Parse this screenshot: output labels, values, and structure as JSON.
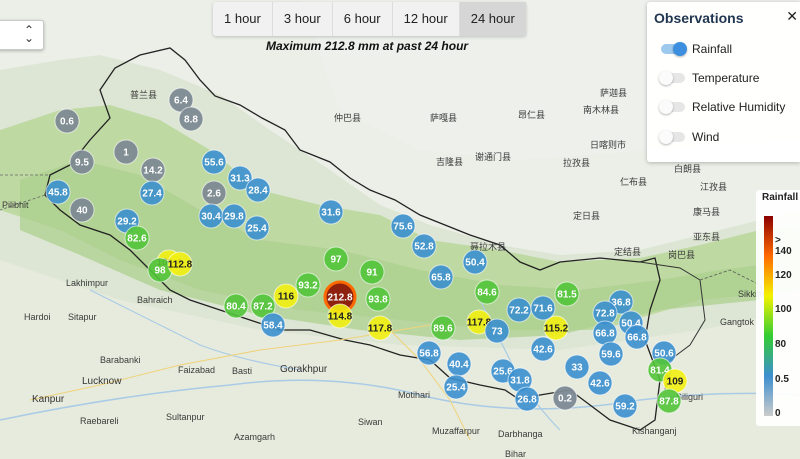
{
  "time_tabs": [
    {
      "label": "1 hour",
      "active": false
    },
    {
      "label": "3 hour",
      "active": false
    },
    {
      "label": "6 hour",
      "active": false
    },
    {
      "label": "12 hour",
      "active": false
    },
    {
      "label": "24 hour",
      "active": true
    }
  ],
  "subtitle": "Maximum 212.8 mm at past 24 hour",
  "observations": {
    "title": "Observations",
    "items": [
      {
        "label": "Rainfall",
        "on": true
      },
      {
        "label": "Temperature",
        "on": false
      },
      {
        "label": "Relative Humidity",
        "on": false
      },
      {
        "label": "Wind",
        "on": false
      }
    ]
  },
  "legend": {
    "title": "Rainfall",
    "stops": [
      {
        "label": "> 140",
        "color": "#8b0000"
      },
      {
        "label": "120",
        "color": "#ff6a00"
      },
      {
        "label": "100",
        "color": "#f3f300"
      },
      {
        "label": "80",
        "color": "#33cc33"
      },
      {
        "label": "0.5",
        "color": "#3d8fcf"
      },
      {
        "label": "0",
        "color": "#cccccc"
      }
    ]
  },
  "place_labels": [
    "Pilibhit",
    "Lakhimpur",
    "Bahraich",
    "Hardoi",
    "Sitapur",
    "Barabanki",
    "Lucknow",
    "Faizabad",
    "Basti",
    "Gorakhpur",
    "Kanpur",
    "Raebareli",
    "Sultanpur",
    "Azamgarh",
    "Motihari",
    "Siwan",
    "Muzaffarpur",
    "Darbhanga",
    "Bihar",
    "Kishanganj",
    "Siliguri",
    "Gangtok",
    "Sikkim"
  ],
  "tibet_labels": [
    "仲巴县",
    "萨嘎县",
    "吉隆县",
    "昂仁县",
    "拉孜县",
    "定日县",
    "定结县",
    "岗巴县",
    "亚东县",
    "康马县",
    "白朗县",
    "聂拉木县",
    "江孜县",
    "南木林县",
    "日喀则市",
    "仁布县",
    "谢通门县",
    "萨迦县",
    "普兰县"
  ],
  "stations": [
    {
      "v": "0.6",
      "c": "gray"
    },
    {
      "v": "6.4",
      "c": "gray"
    },
    {
      "v": "8.8",
      "c": "gray"
    },
    {
      "v": "1",
      "c": "gray"
    },
    {
      "v": "9.5",
      "c": "gray"
    },
    {
      "v": "14.2",
      "c": "gray"
    },
    {
      "v": "55.6",
      "c": "blue"
    },
    {
      "v": "45.8",
      "c": "blue"
    },
    {
      "v": "27.4",
      "c": "blue"
    },
    {
      "v": "2.6",
      "c": "gray"
    },
    {
      "v": "31.3",
      "c": "blue"
    },
    {
      "v": "28.4",
      "c": "blue"
    },
    {
      "v": "40",
      "c": "gray"
    },
    {
      "v": "29.2",
      "c": "blue"
    },
    {
      "v": "30.4",
      "c": "blue"
    },
    {
      "v": "29.8",
      "c": "blue"
    },
    {
      "v": "82.6",
      "c": "green"
    },
    {
      "v": "25.4",
      "c": "blue"
    },
    {
      "v": "31.6",
      "c": "blue"
    },
    {
      "v": "75.6",
      "c": "blue"
    },
    {
      "v": "52.8",
      "c": "blue"
    },
    {
      "v": "106.4",
      "c": "yellow"
    },
    {
      "v": "98",
      "c": "green"
    },
    {
      "v": "112.8",
      "c": "yellow"
    },
    {
      "v": "97",
      "c": "green"
    },
    {
      "v": "91",
      "c": "green"
    },
    {
      "v": "65.8",
      "c": "blue"
    },
    {
      "v": "50.4",
      "c": "blue"
    },
    {
      "v": "116",
      "c": "yellow"
    },
    {
      "v": "93.2",
      "c": "green"
    },
    {
      "v": "212.8",
      "c": "darkred"
    },
    {
      "v": "93.8",
      "c": "green"
    },
    {
      "v": "84.6",
      "c": "green"
    },
    {
      "v": "81.5",
      "c": "green"
    },
    {
      "v": "36.8",
      "c": "blue"
    },
    {
      "v": "80.4",
      "c": "green"
    },
    {
      "v": "87.2",
      "c": "green"
    },
    {
      "v": "58.4",
      "c": "blue"
    },
    {
      "v": "114.8",
      "c": "yellow"
    },
    {
      "v": "117.8",
      "c": "yellow"
    },
    {
      "v": "89.6",
      "c": "green"
    },
    {
      "v": "117.8",
      "c": "yellow"
    },
    {
      "v": "72.2",
      "c": "blue"
    },
    {
      "v": "115.2",
      "c": "yellow"
    },
    {
      "v": "72.8",
      "c": "blue"
    },
    {
      "v": "66.8",
      "c": "blue"
    },
    {
      "v": "56.8",
      "c": "blue"
    },
    {
      "v": "73",
      "c": "blue"
    },
    {
      "v": "40.4",
      "c": "blue"
    },
    {
      "v": "25.6",
      "c": "blue"
    },
    {
      "v": "31.8",
      "c": "blue"
    },
    {
      "v": "33",
      "c": "blue"
    },
    {
      "v": "42.6",
      "c": "blue"
    },
    {
      "v": "59.6",
      "c": "blue"
    },
    {
      "v": "50.6",
      "c": "blue"
    },
    {
      "v": "81.4",
      "c": "green"
    },
    {
      "v": "109",
      "c": "yellow"
    },
    {
      "v": "87.8",
      "c": "green"
    },
    {
      "v": "59.2",
      "c": "blue"
    },
    {
      "v": "26.8",
      "c": "blue"
    },
    {
      "v": "25.4",
      "c": "blue"
    },
    {
      "v": "42.6",
      "c": "blue"
    },
    {
      "v": "50.4",
      "c": "blue"
    },
    {
      "v": "66.8",
      "c": "blue"
    },
    {
      "v": "71.6",
      "c": "blue"
    },
    {
      "v": "0.2",
      "c": "gray"
    }
  ]
}
